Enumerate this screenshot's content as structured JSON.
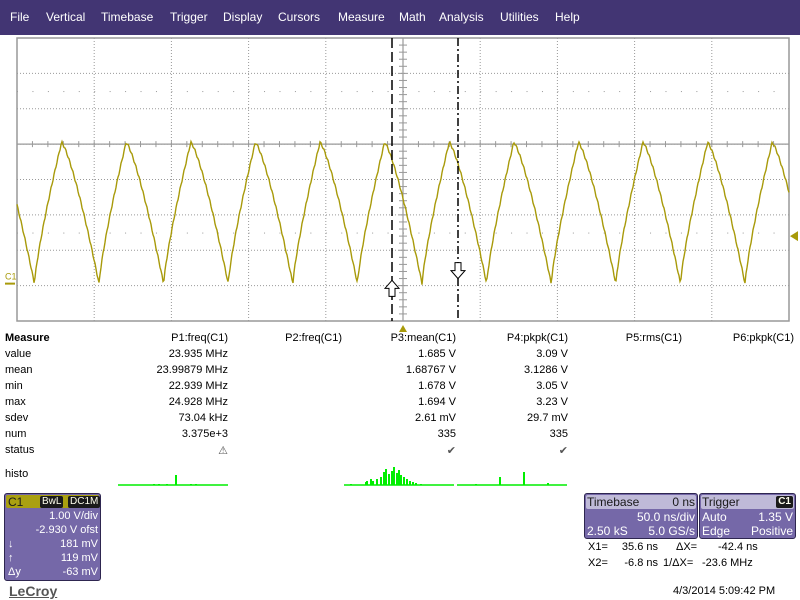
{
  "menu": [
    "File",
    "Vertical",
    "Timebase",
    "Trigger",
    "Display",
    "Cursors",
    "Measure",
    "Math",
    "Analysis",
    "Utilities",
    "Help"
  ],
  "trace": {
    "label": "C1",
    "color": "#a89a0a",
    "cursor1_icon": "up-arrow-cursor-icon",
    "cursor2_icon": "down-arrow-cursor-icon"
  },
  "measure": {
    "title": "Measure",
    "row_labels": [
      "value",
      "mean",
      "min",
      "max",
      "sdev",
      "num",
      "status"
    ],
    "columns": [
      {
        "header": "P1:freq(C1)",
        "values": [
          "23.935 MHz",
          "23.99879 MHz",
          "22.939 MHz",
          "24.928 MHz",
          "73.04 kHz",
          "3.375e+3"
        ],
        "status": "warning-icon"
      },
      {
        "header": "P2:freq(C1)",
        "values": [
          "",
          "",
          "",
          "",
          "",
          ""
        ],
        "status": ""
      },
      {
        "header": "P3:mean(C1)",
        "values": [
          "1.685 V",
          "1.68767 V",
          "1.678 V",
          "1.694 V",
          "2.61 mV",
          "335"
        ],
        "status": "check-icon"
      },
      {
        "header": "P4:pkpk(C1)",
        "values": [
          "3.09 V",
          "3.1286 V",
          "3.05 V",
          "3.23 V",
          "29.7 mV",
          "335"
        ],
        "status": "check-icon"
      },
      {
        "header": "P5:rms(C1)",
        "values": [
          "",
          "",
          "",
          "",
          "",
          ""
        ],
        "status": ""
      },
      {
        "header": "P6:pkpk(C1)",
        "values": [
          "",
          "",
          "",
          "",
          "",
          ""
        ],
        "status": ""
      }
    ],
    "histo_label": "histo",
    "histo_color": "#00ee00"
  },
  "channel": {
    "name": "C1",
    "tags": [
      "BwL",
      "DC1M"
    ],
    "vdiv": "1.00 V/div",
    "offset": "-2.930 V ofst",
    "down_label": "↓",
    "down_value": "181 mV",
    "up_label": "↑",
    "up_value": "119 mV",
    "dy_label": "Δy",
    "dy_value": "-63 mV"
  },
  "timebase": {
    "title": "Timebase",
    "delay": "0 ns",
    "tdiv": "50.0 ns/div",
    "samples": "2.50 kS",
    "rate": "5.0 GS/s"
  },
  "trigger": {
    "title": "Trigger",
    "source": "C1",
    "mode": "Auto",
    "level": "1.35 V",
    "type": "Edge",
    "slope": "Positive"
  },
  "cursors": {
    "x1_label": "X1=",
    "x1": "35.6 ns",
    "dx_label": "ΔX=",
    "dx": "-42.4 ns",
    "x2_label": "X2=",
    "x2": "-6.8 ns",
    "inv_label": "1/ΔX=",
    "inv": "-23.6 MHz"
  },
  "datetime": "4/3/2014 5:09:42 PM",
  "brand": "LeCroy"
}
